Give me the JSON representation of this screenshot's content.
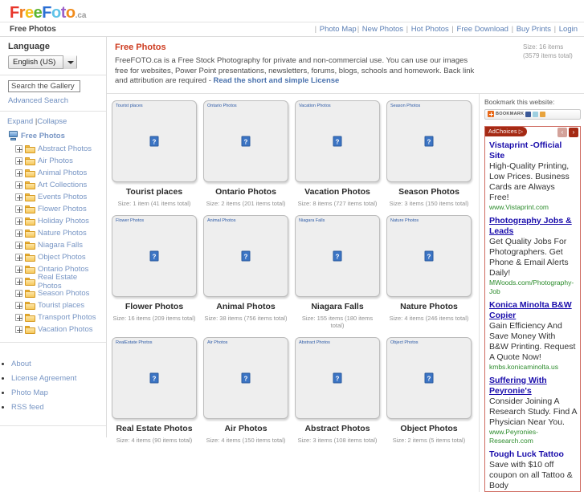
{
  "site": {
    "logo_parts": [
      {
        "t": "F",
        "c": "#e8362a"
      },
      {
        "t": "r",
        "c": "#f07c1e"
      },
      {
        "t": "e",
        "c": "#f4c21a"
      },
      {
        "t": "e",
        "c": "#5cb531"
      },
      {
        "t": "F",
        "c": "#2a6fd4"
      },
      {
        "t": "o",
        "c": "#5fc3e8"
      },
      {
        "t": "t",
        "c": "#9b5fc8"
      },
      {
        "t": "o",
        "c": "#f08c1e"
      }
    ],
    "logo_domain": ".ca",
    "breadcrumb": "Free Photos"
  },
  "topnav": {
    "items": [
      "Photo Map",
      "New Photos",
      "Hot Photos",
      "Free Download",
      "Buy Prints",
      "Login"
    ]
  },
  "sidebar": {
    "language_heading": "Language",
    "language_value": "English (US)",
    "search_placeholder": "Search the Gallery",
    "search_value": "Search the Gallery",
    "advanced_search": "Advanced Search",
    "expand": "Expand",
    "collapse": "Collapse",
    "root_label": "Free Photos",
    "tree": [
      "Abstract Photos",
      "Air Photos",
      "Animal Photos",
      "Art Collections",
      "Events Photos",
      "Flower Photos",
      "Holiday Photos",
      "Nature Photos",
      "Niagara Falls",
      "Object Photos",
      "Ontario Photos",
      "Real Estate Photos",
      "Season Photos",
      "Tourist places",
      "Transport Photos",
      "Vacation Photos"
    ],
    "links": [
      "About",
      "License Agreement",
      "Photo Map",
      "RSS feed"
    ]
  },
  "main": {
    "title": "Free Photos",
    "description": "FreeFOTO.ca is a Free Stock Photography for private and non-commercial use. You can use our images free for websites, Power Point presentations, newsletters, forums, blogs, schools and homework. Back link and attribution are required - ",
    "license_link": "Read the short and simple License",
    "size_note": "Size: 16 items (3579 items total)",
    "albums": [
      {
        "title": "Tourist places",
        "alt": "Tourist places",
        "size": "Size: 1 item (41 items total)"
      },
      {
        "title": "Ontario Photos",
        "alt": "Ontario Photos",
        "size": "Size: 2 items (201 items total)"
      },
      {
        "title": "Vacation Photos",
        "alt": "Vacation Photos",
        "size": "Size: 8 items (727 items total)"
      },
      {
        "title": "Season Photos",
        "alt": "Season Photos",
        "size": "Size: 3 items (150 items total)"
      },
      {
        "title": "Flower Photos",
        "alt": "Flower Photos",
        "size": "Size: 16 items (209 items total)"
      },
      {
        "title": "Animal Photos",
        "alt": "Animal Photos",
        "size": "Size: 38 items (756 items total)"
      },
      {
        "title": "Niagara Falls",
        "alt": "Niagara Falls",
        "size": "Size: 155 items (180 items total)"
      },
      {
        "title": "Nature Photos",
        "alt": "Nature Photos",
        "size": "Size: 4 items (246 items total)"
      },
      {
        "title": "Real Estate Photos",
        "alt": "RealEstate Photos",
        "size": "Size: 4 items (90 items total)"
      },
      {
        "title": "Air Photos",
        "alt": "Air Photos",
        "size": "Size: 4 items (150 items total)"
      },
      {
        "title": "Abstract Photos",
        "alt": "Abstract Photos",
        "size": "Size: 3 items (108 items total)"
      },
      {
        "title": "Object Photos",
        "alt": "Object Photos",
        "size": "Size: 2 items (5 items total)"
      }
    ]
  },
  "ads": {
    "bookmark_heading": "Bookmark this website:",
    "bookmark_label": "BOOKMARK",
    "adchoices_label": "AdChoices",
    "prev_arrow": "‹",
    "next_arrow": "›",
    "items": [
      {
        "title": "Vistaprint -Official Site",
        "text": "High-Quality Printing, Low Prices. Business Cards are Always Free!",
        "url": "www.Vistaprint.com",
        "underline": false
      },
      {
        "title": "Photography Jobs & Leads",
        "text": "Get Quality Jobs For Photographers. Get Phone & Email Alerts Daily!",
        "url": "MWoods.com/Photography-Job",
        "underline": true
      },
      {
        "title": "Konica Minolta B&W Copier",
        "text": "Gain Efficiency And Save Money With B&W Printing. Request A Quote Now!",
        "url": "kmbs.konicaminolta.us",
        "underline": true
      },
      {
        "title": "Suffering With Peyronie's",
        "text": "Consider Joining A Research Study. Find A Physician Near You.",
        "url": "www.Peyronies-Research.com",
        "underline": true
      },
      {
        "title": "Tough Luck Tattoo",
        "text": "Save with $10 off coupon on all Tattoo & Body",
        "url": "",
        "underline": false
      }
    ]
  }
}
